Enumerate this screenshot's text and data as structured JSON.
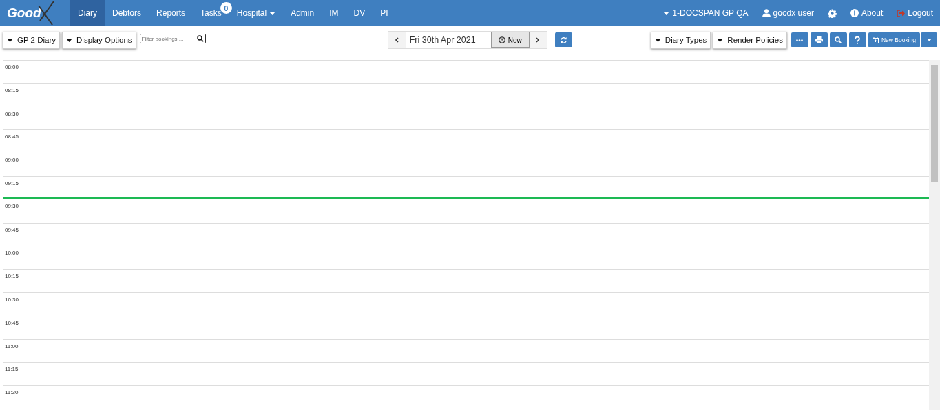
{
  "logo": {
    "text": "Good"
  },
  "nav": [
    {
      "label": "Diary",
      "selected": true
    },
    {
      "label": "Debtors",
      "selected": false
    },
    {
      "label": "Reports",
      "selected": false
    },
    {
      "label": "Tasks",
      "selected": false,
      "badge": "0"
    },
    {
      "label": "Hospital",
      "selected": false,
      "dropdown": true
    },
    {
      "label": "Admin",
      "selected": false
    },
    {
      "label": "IM",
      "selected": false
    },
    {
      "label": "DV",
      "selected": false
    },
    {
      "label": "PI",
      "selected": false
    }
  ],
  "nav_right": [
    {
      "kind": "practice",
      "label": "1-DOCSPAN GP QA"
    },
    {
      "kind": "user",
      "label": "goodx user"
    },
    {
      "kind": "settings"
    },
    {
      "kind": "about",
      "label": "About"
    },
    {
      "kind": "logout",
      "label": "Logout"
    }
  ],
  "toolbar": {
    "diary_dropdown": "GP 2 Diary",
    "display_options": "Display Options",
    "filter": {
      "placeholder": "Filter bookings ..."
    },
    "date": "Fri 30th Apr 2021",
    "now_button": "Now",
    "diary_types": "Diary Types",
    "render_policies": "Render Policies",
    "new_booking": "New Booking"
  },
  "slots": [
    {
      "time": "08:00",
      "current_time": false
    },
    {
      "time": "08:15",
      "current_time": false
    },
    {
      "time": "08:30",
      "current_time": false
    },
    {
      "time": "08:45",
      "current_time": false
    },
    {
      "time": "09:00",
      "current_time": false
    },
    {
      "time": "09:15",
      "current_time": true
    },
    {
      "time": "09:30",
      "current_time": false
    },
    {
      "time": "09:45",
      "current_time": false
    },
    {
      "time": "10:00",
      "current_time": false
    },
    {
      "time": "10:15",
      "current_time": false
    },
    {
      "time": "10:30",
      "current_time": false
    },
    {
      "time": "10:45",
      "current_time": false
    },
    {
      "time": "11:00",
      "current_time": false
    },
    {
      "time": "11:15",
      "current_time": false
    },
    {
      "time": "11:30",
      "current_time": false
    }
  ]
}
